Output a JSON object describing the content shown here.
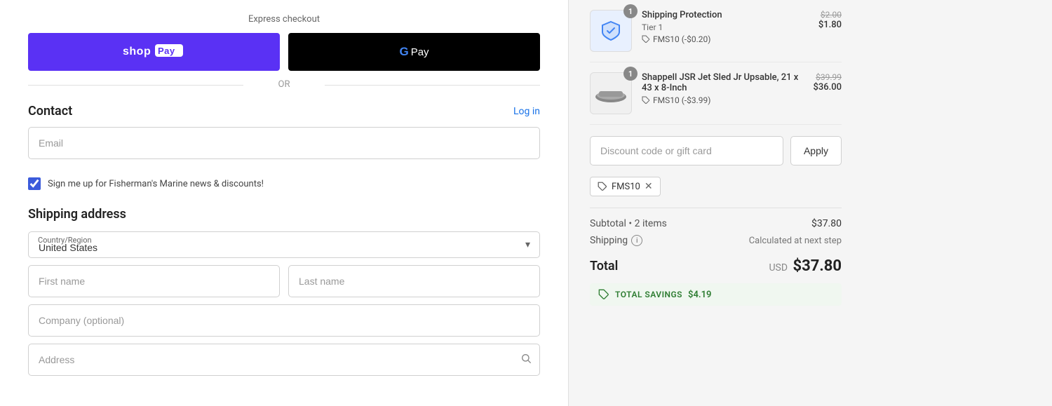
{
  "left": {
    "express_checkout_label": "Express checkout",
    "shop_pay_label": "shop Pay",
    "google_pay_label": "G Pay",
    "or_label": "OR",
    "contact": {
      "title": "Contact",
      "log_in_label": "Log in",
      "email_placeholder": "Email",
      "newsletter_label": "Sign me up for Fisherman's Marine news & discounts!"
    },
    "shipping": {
      "title": "Shipping address",
      "country_label": "Country/Region",
      "country_value": "United States",
      "first_name_placeholder": "First name",
      "last_name_placeholder": "Last name",
      "company_placeholder": "Company (optional)",
      "address_placeholder": "Address"
    }
  },
  "right": {
    "items": [
      {
        "name": "Shipping Protection",
        "tier": "Tier 1",
        "discount": "FMS10 (-$0.20)",
        "price_original": "$2.00",
        "price_current": "$1.80",
        "quantity": 1,
        "image_type": "shield"
      },
      {
        "name": "Shappell JSR Jet Sled Jr Upsable, 21 x 43 x 8-Inch",
        "tier": "",
        "discount": "FMS10 (-$3.99)",
        "price_original": "$39.99",
        "price_current": "$36.00",
        "quantity": 1,
        "image_type": "sled"
      }
    ],
    "discount": {
      "placeholder": "Discount code or gift card",
      "apply_label": "Apply"
    },
    "coupon_code": "FMS10",
    "subtotal_label": "Subtotal",
    "subtotal_count": "2 items",
    "subtotal_value": "$37.80",
    "shipping_label": "Shipping",
    "shipping_value": "Calculated at next step",
    "total_label": "Total",
    "total_currency": "USD",
    "total_value": "$37.80",
    "savings_label": "TOTAL SAVINGS",
    "savings_value": "$4.19"
  }
}
